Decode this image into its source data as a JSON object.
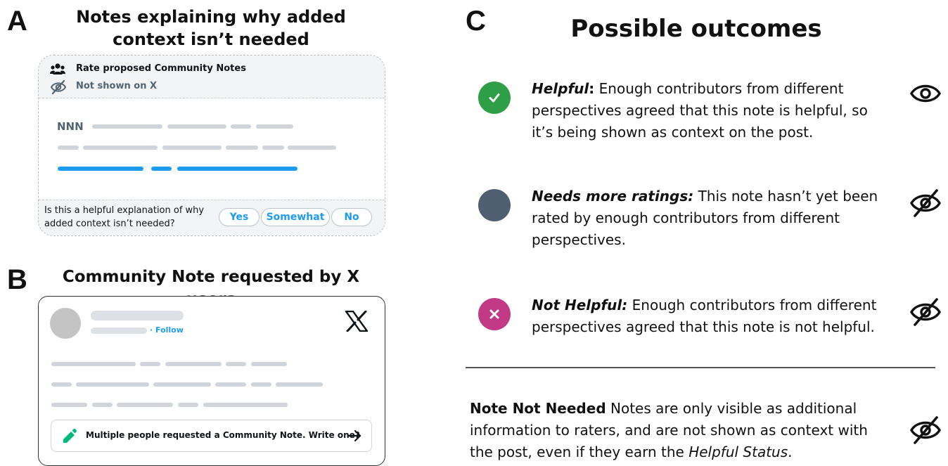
{
  "panel_a": {
    "letter": "A",
    "title_line1": "Notes explaining why added",
    "title_line2": "context isn’t needed",
    "header_title": "Rate proposed Community Notes",
    "header_status": "Not shown on X",
    "note_prefix": "NNN",
    "question_line1": "Is this a helpful explanation of why",
    "question_line2": "added context isn’t needed?",
    "buttons": [
      "Yes",
      "Somewhat",
      "No"
    ],
    "colors": {
      "link_blue": "#1d9bf0",
      "placeholder_grey": "#cfd5da"
    }
  },
  "panel_b": {
    "letter": "B",
    "title": "Community Note requested by X users",
    "follow_label": "· Follow",
    "brand_logo": "X",
    "request_text": "Multiple people requested a Community Note. Write one?",
    "icons": [
      "pencil-icon",
      "arrow-right-icon",
      "x-logo-icon"
    ]
  },
  "panel_c": {
    "letter": "C",
    "title": "Possible outcomes",
    "outcomes": [
      {
        "status": "Helpful",
        "status_suffix": ":",
        "text_line1": " Enough contributors from different",
        "text_line2": "perspectives agreed that this note is helpful, so",
        "text_line3": "it’s being shown as context on the post.",
        "dot_color": "#2e9e47",
        "dot_icon": "check-icon",
        "visibility_icon": "eye-icon"
      },
      {
        "status": "Needs more ratings:",
        "text_line1": " This note hasn’t yet been",
        "text_line2": "rated by enough contributors from different",
        "text_line3": "perspectives.",
        "dot_color": "#4f5e70",
        "visibility_icon": "eye-off-icon"
      },
      {
        "status": "Not Helpful:",
        "text_line1": " Enough contributors from different",
        "text_line2": "perspectives agreed that this note is not helpful.",
        "dot_color": "#c23a86",
        "dot_icon": "x-icon",
        "visibility_icon": "eye-off-icon"
      }
    ],
    "not_needed": {
      "label": "Note Not Needed",
      "text_line1": " Notes are only visible as additional",
      "text_line2": "information to raters, and are not shown as context with",
      "text_line3a": "the post, even if they earn the ",
      "text_line3_italic": "Helpful Status",
      "text_line3b": ".",
      "visibility_icon": "eye-off-icon"
    }
  }
}
